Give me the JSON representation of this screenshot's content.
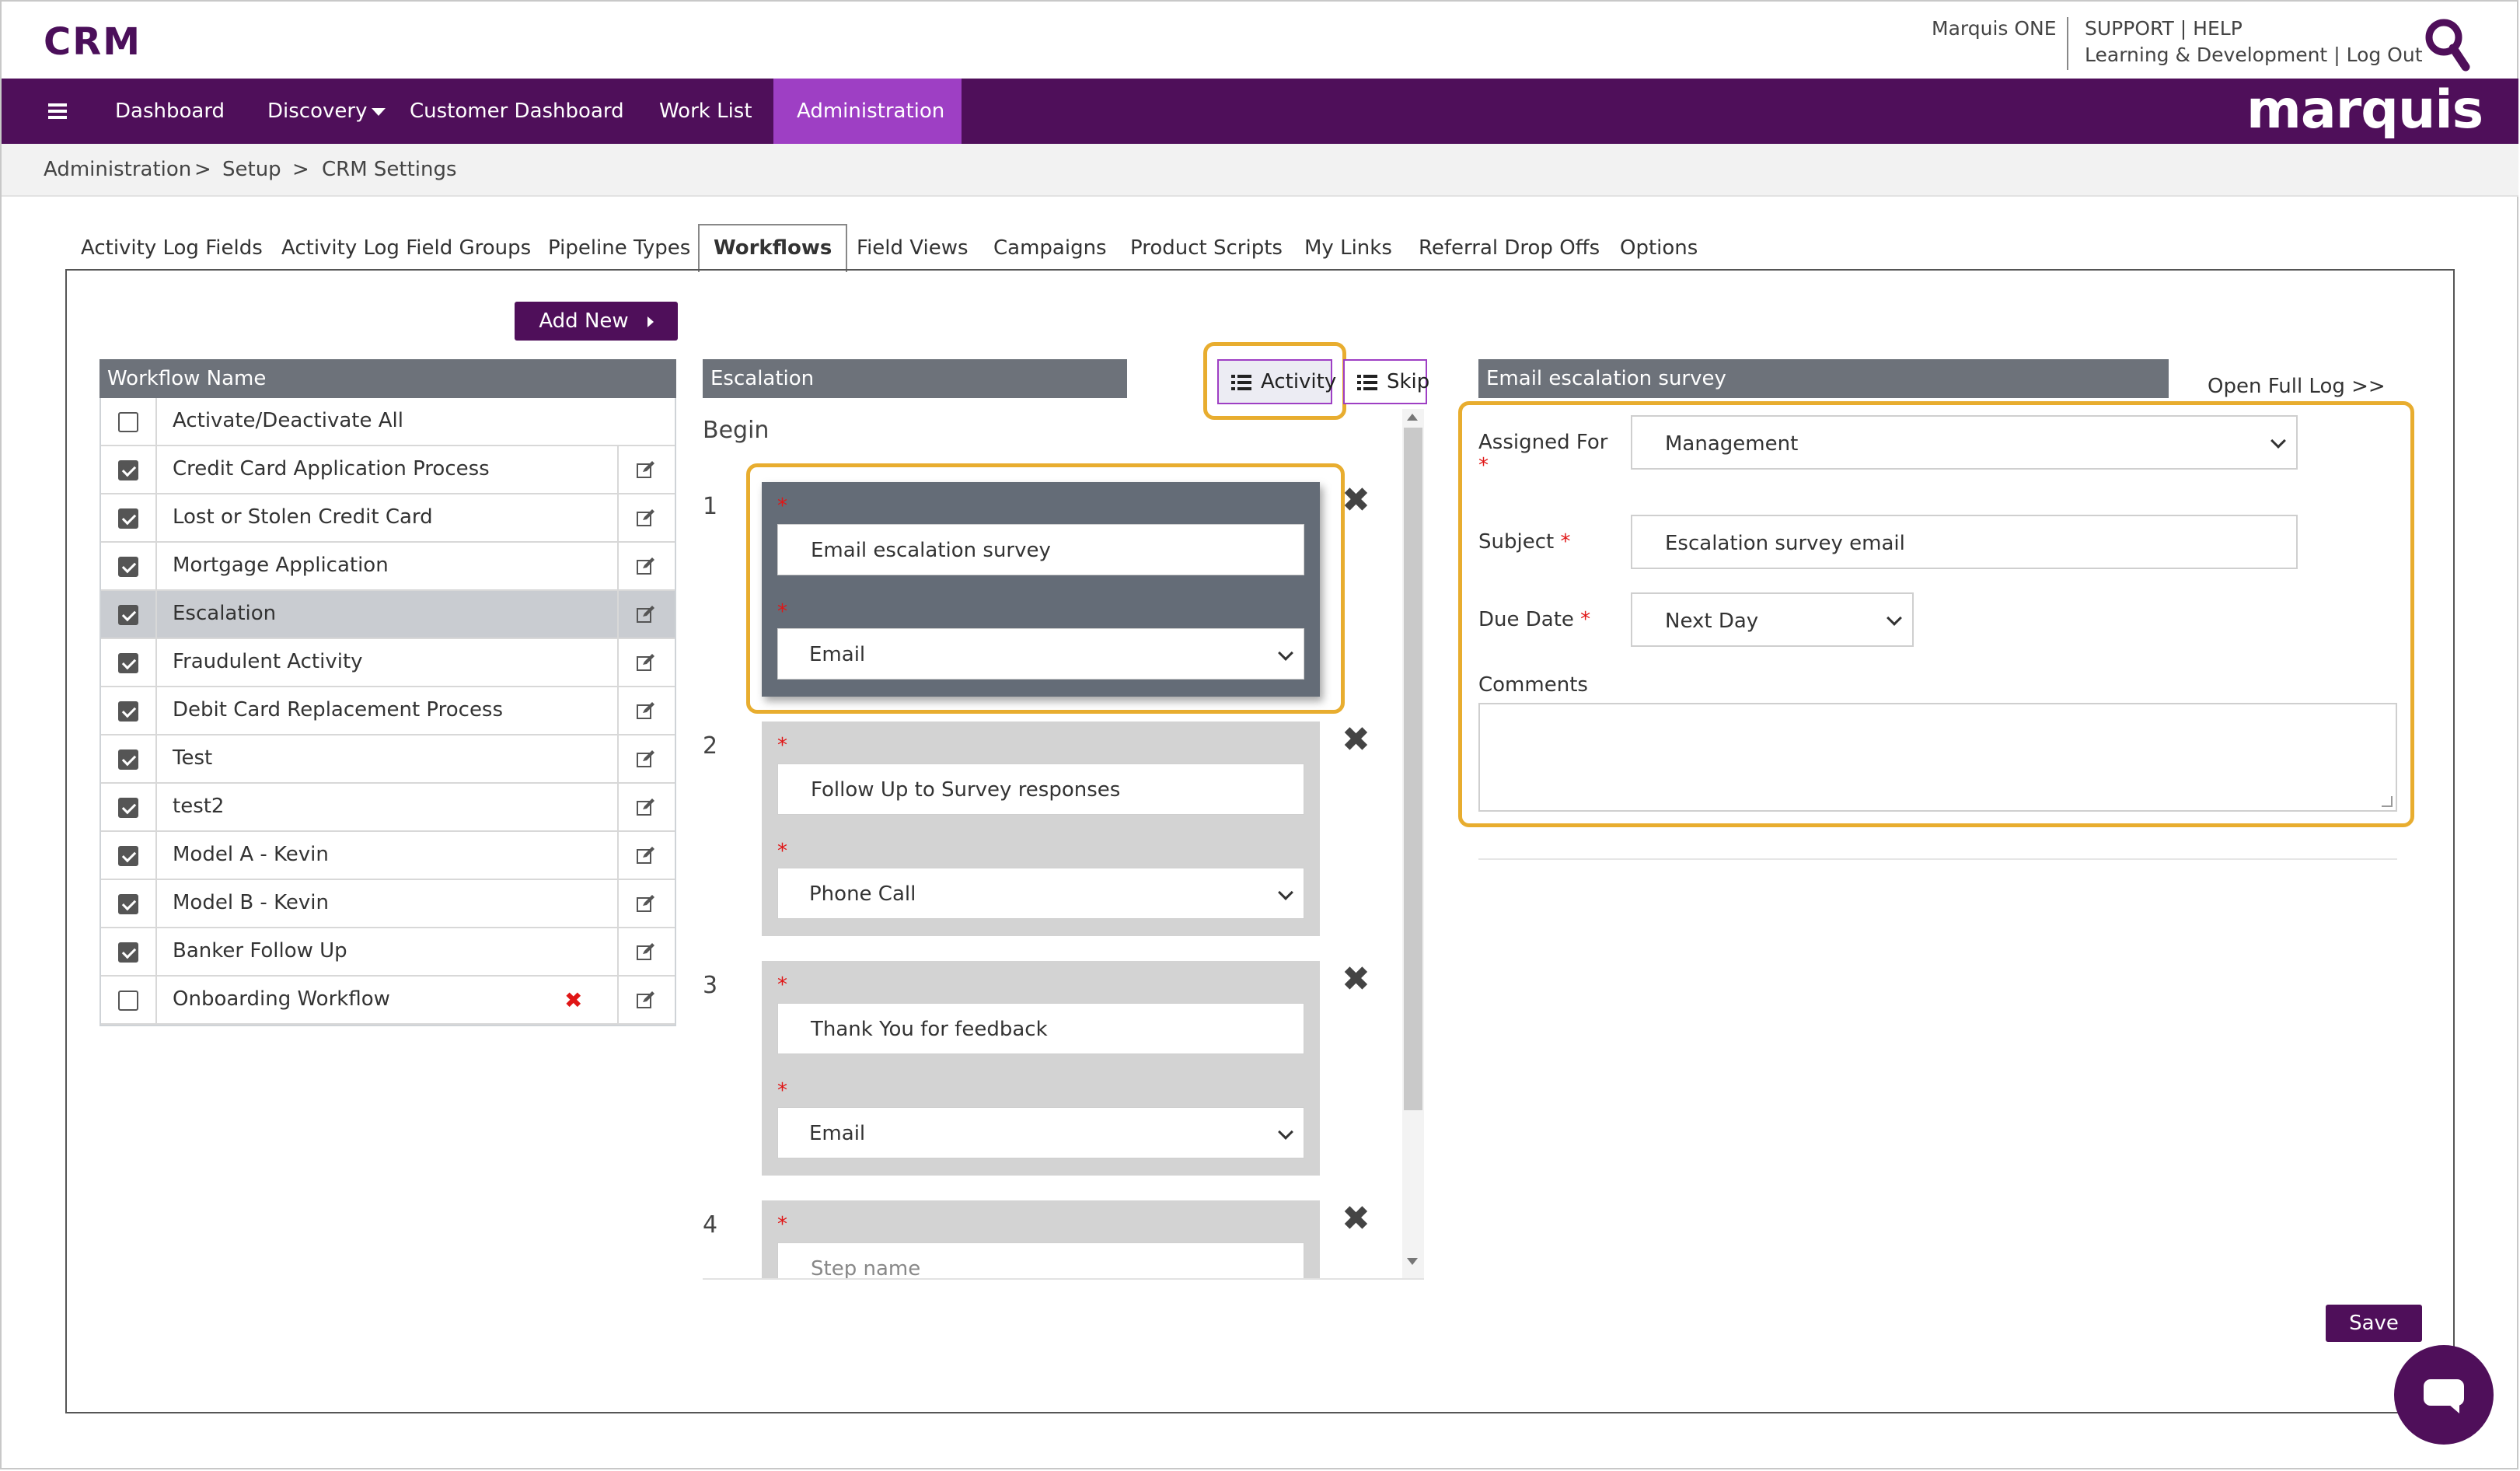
{
  "header": {
    "app_title": "CRM",
    "marquis_one": "Marquis ONE",
    "support": "SUPPORT",
    "help": "HELP",
    "separator": "|",
    "learning": "Learning & Development",
    "logout": "Log Out"
  },
  "nav": {
    "items": [
      "Dashboard",
      "Discovery",
      "Customer Dashboard",
      "Work List",
      "Administration"
    ],
    "brand": "marquis"
  },
  "breadcrumb": [
    "Administration",
    ">",
    "Setup",
    ">",
    "CRM Settings"
  ],
  "tabs": [
    "Activity Log Fields",
    "Activity Log Field Groups",
    "Pipeline Types",
    "Workflows",
    "Field Views",
    "Campaigns",
    "Product Scripts",
    "My Links",
    "Referral Drop Offs",
    "Options"
  ],
  "add_new_label": "Add New",
  "workflow_table": {
    "header": "Workflow Name",
    "select_all": "Activate/Deactivate All",
    "rows": [
      {
        "name": "Credit Card Application Process",
        "checked": true
      },
      {
        "name": "Lost or Stolen Credit Card",
        "checked": true
      },
      {
        "name": "Mortgage Application",
        "checked": true
      },
      {
        "name": "Escalation",
        "checked": true,
        "selected": true
      },
      {
        "name": "Fraudulent Activity",
        "checked": true
      },
      {
        "name": "Debit Card Replacement Process",
        "checked": true
      },
      {
        "name": "Test",
        "checked": true
      },
      {
        "name": "test2",
        "checked": true
      },
      {
        "name": "Model A - Kevin",
        "checked": true
      },
      {
        "name": "Model B - Kevin",
        "checked": true
      },
      {
        "name": "Banker Follow Up",
        "checked": true
      },
      {
        "name": "Onboarding Workflow",
        "checked": false,
        "deletable": true
      }
    ]
  },
  "steps_panel": {
    "title": "Escalation",
    "activity_label": "Activity",
    "skip_label": "Skip",
    "begin": "Begin",
    "required_mark": "*",
    "steps": [
      {
        "num": "1",
        "name": "Email escalation survey",
        "type": "Email"
      },
      {
        "num": "2",
        "name": "Follow Up to Survey responses",
        "type": "Phone Call"
      },
      {
        "num": "3",
        "name": "Thank You for feedback",
        "type": "Email"
      },
      {
        "num": "4",
        "placeholder": "Step name"
      }
    ]
  },
  "detail_panel": {
    "title": "Email escalation survey",
    "open_full_log": "Open Full Log >>",
    "assigned_for_label": "Assigned For",
    "assigned_for_value": "Management",
    "subject_label": "Subject",
    "subject_value": "Escalation survey email",
    "due_date_label": "Due Date",
    "due_date_value": "Next Day",
    "comments_label": "Comments",
    "required_mark": "*"
  },
  "save_label": "Save",
  "colors": {
    "brand_purple": "#4f0f5a",
    "active_nav": "#9e3fc4",
    "highlight": "#e8ad2f",
    "panel_header": "#6d727a"
  }
}
